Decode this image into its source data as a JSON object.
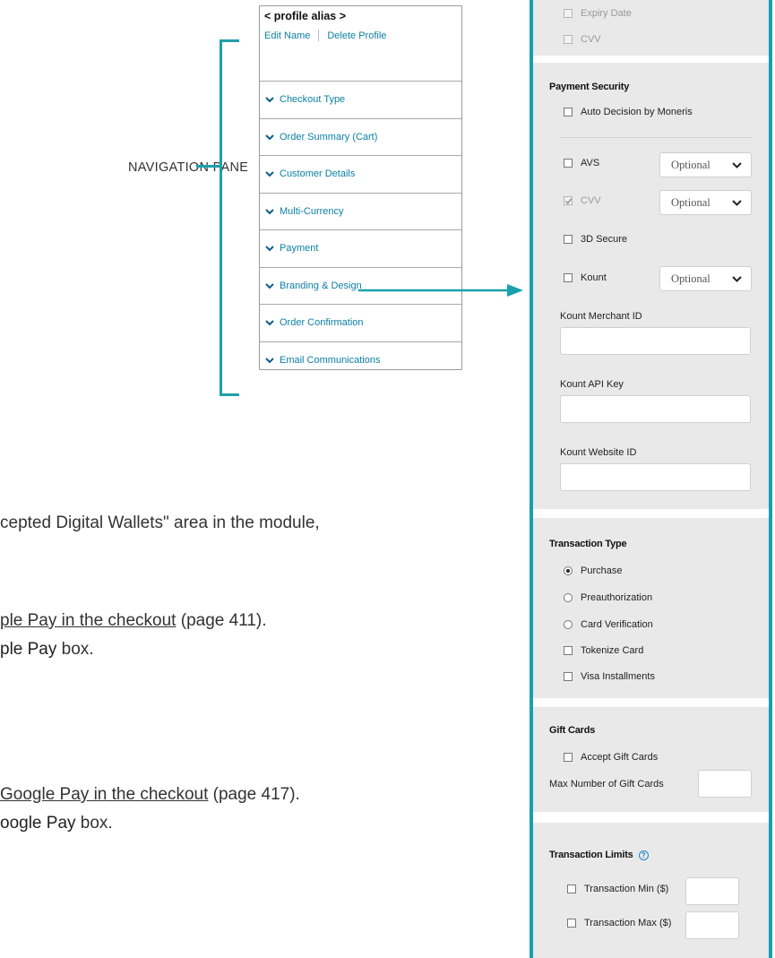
{
  "nav": {
    "alias": "< profile alias >",
    "edit_name": "Edit Name",
    "delete_profile": "Delete Profile",
    "items": [
      {
        "label": "Checkout Type"
      },
      {
        "label": "Order Summary (Cart)"
      },
      {
        "label": "Customer Details"
      },
      {
        "label": "Multi-Currency"
      },
      {
        "label": "Payment"
      },
      {
        "label": "Branding & Design"
      },
      {
        "label": "Order Confirmation"
      },
      {
        "label": "Email Communications"
      }
    ],
    "pane_label": "NAVIGATION PANE"
  },
  "body_text": {
    "line1": "cepted Digital Wallets\" area in the module,",
    "line2_link": "ple Pay in the checkout",
    "line2_rest": " (page 411).",
    "line3_bold": "ple Pay",
    "line3_rest": " box.",
    "line4_link": "Google Pay in the checkout",
    "line4_rest": " (page 417).",
    "line5_bold": "oogle Pay",
    "line5_rest": " box."
  },
  "panel": {
    "card_fields": {
      "expiry": "Expiry Date",
      "cvv": "CVV"
    },
    "payment_security": {
      "heading": "Payment Security",
      "auto_decision": "Auto Decision by Moneris",
      "avs": "AVS",
      "avs_option": "Optional",
      "cvv": "CVV",
      "cvv_option": "Optional",
      "three_d": "3D Secure",
      "kount": "Kount",
      "kount_option": "Optional",
      "merchant_id_label": "Kount Merchant ID",
      "api_key_label": "Kount API Key",
      "website_id_label": "Kount Website ID"
    },
    "transaction_type": {
      "heading": "Transaction Type",
      "purchase": "Purchase",
      "preauth": "Preauthorization",
      "card_verification": "Card Verification",
      "tokenize": "Tokenize Card",
      "visa_installments": "Visa Installments"
    },
    "gift_cards": {
      "heading": "Gift Cards",
      "accept": "Accept Gift Cards",
      "max_label": "Max Number of Gift Cards"
    },
    "limits": {
      "heading": "Transaction Limits",
      "help": "?",
      "min": "Transaction Min ($)",
      "max": "Transaction Max ($)"
    }
  },
  "colors": {
    "accent": "#18a0ad",
    "link": "#0b7fa6",
    "panel_bg": "#e9e9e9"
  }
}
